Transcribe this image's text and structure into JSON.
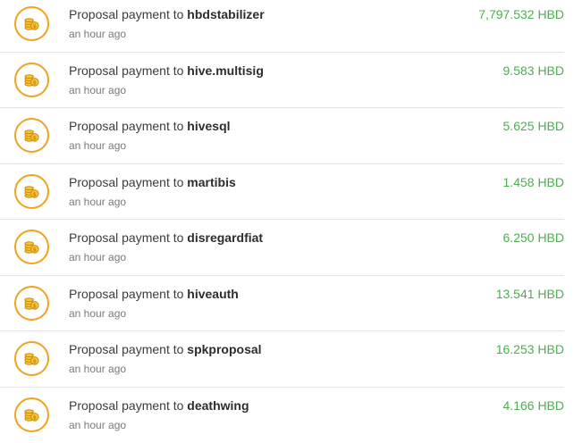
{
  "colors": {
    "accent_ring": "#f0a31c",
    "amount": "#4caf50",
    "divider": "#e4e4e4"
  },
  "icon": "coins-icon",
  "transactions": [
    {
      "label": "Proposal payment to",
      "recipient": "hbdstabilizer",
      "time": "an hour ago",
      "amount": "7,797.532 HBD"
    },
    {
      "label": "Proposal payment to",
      "recipient": "hive.multisig",
      "time": "an hour ago",
      "amount": "9.583 HBD"
    },
    {
      "label": "Proposal payment to",
      "recipient": "hivesql",
      "time": "an hour ago",
      "amount": "5.625 HBD"
    },
    {
      "label": "Proposal payment to",
      "recipient": "martibis",
      "time": "an hour ago",
      "amount": "1.458 HBD"
    },
    {
      "label": "Proposal payment to",
      "recipient": "disregardfiat",
      "time": "an hour ago",
      "amount": "6.250 HBD"
    },
    {
      "label": "Proposal payment to",
      "recipient": "hiveauth",
      "time": "an hour ago",
      "amount": "13.541 HBD"
    },
    {
      "label": "Proposal payment to",
      "recipient": "spkproposal",
      "time": "an hour ago",
      "amount": "16.253 HBD"
    },
    {
      "label": "Proposal payment to",
      "recipient": "deathwing",
      "time": "an hour ago",
      "amount": "4.166 HBD"
    }
  ]
}
